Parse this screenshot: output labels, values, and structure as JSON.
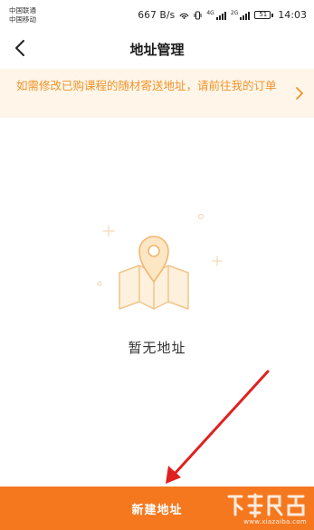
{
  "status_bar": {
    "carrier_1": "中国联通",
    "carrier_2": "中国移动",
    "net_speed": "667 B/s",
    "signal_tag_1": "4G",
    "signal_tag_2": "2G",
    "battery": "51",
    "time": "14:03"
  },
  "header": {
    "title": "地址管理",
    "back_icon": "chevron-left-icon"
  },
  "notice": {
    "text": "如需修改已购课程的随材寄送地址，请前往我的订单",
    "arrow_icon": "chevron-right-icon"
  },
  "empty_state": {
    "illustration": "map-pin-icon",
    "text": "暂无地址"
  },
  "footer": {
    "add_button_label": "新建地址"
  },
  "watermark": {
    "site": "www.xiazaiba.com"
  },
  "colors": {
    "accent": "#f5781f",
    "notice_bg": "#fff6e9",
    "notice_text": "#f0932a",
    "annotation_arrow": "#e02020"
  }
}
